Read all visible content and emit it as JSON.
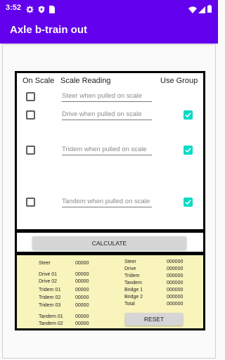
{
  "status_bar": {
    "time": "3:52",
    "icons": [
      "gear-icon",
      "shield-icon",
      "sim-card-icon",
      "wifi-icon",
      "signal-icon",
      "battery-icon"
    ]
  },
  "app_bar": {
    "title": "Axle b-train out"
  },
  "headers": {
    "on_scale": "On Scale",
    "scale_reading": "Scale Reading",
    "use_group": "Use Group"
  },
  "rows": [
    {
      "placeholder": "Steer when pulled on scale",
      "value": "",
      "on_scale": false,
      "use_group": null
    },
    {
      "placeholder": "Drive when pulled on scale",
      "value": "",
      "on_scale": false,
      "use_group": true
    },
    {
      "placeholder": "Tridem when pulled on scale",
      "value": "",
      "on_scale": false,
      "use_group": true
    },
    {
      "placeholder": "Tandem when pulled on scale",
      "value": "",
      "on_scale": false,
      "use_group": true
    }
  ],
  "calculate_label": "CALCULATE",
  "results_left": [
    {
      "label": "Steer",
      "value": "00000"
    },
    {
      "label": "Drive 01",
      "value": "00000"
    },
    {
      "label": "Drive 02",
      "value": "00000"
    },
    {
      "label": "Tridem 01",
      "value": "00000"
    },
    {
      "label": "Tridem 02",
      "value": "00000"
    },
    {
      "label": "Tridem 03",
      "value": "00000"
    },
    {
      "label": "Tandem 01",
      "value": "00000"
    },
    {
      "label": "Tandem 02",
      "value": "00000"
    }
  ],
  "results_right": [
    {
      "label": "Steer",
      "value": "000000"
    },
    {
      "label": "Drive",
      "value": "000000"
    },
    {
      "label": "Tridem",
      "value": "000000"
    },
    {
      "label": "Tandem",
      "value": "000000"
    },
    {
      "label": "Bridge 1",
      "value": "000000"
    },
    {
      "label": "Bridge 2",
      "value": "000000"
    },
    {
      "label": "Total",
      "value": "000000"
    }
  ],
  "reset_label": "RESET",
  "colors": {
    "primary": "#6200ee",
    "accent": "#03dac5",
    "results_bg": "#f9f4bc"
  }
}
